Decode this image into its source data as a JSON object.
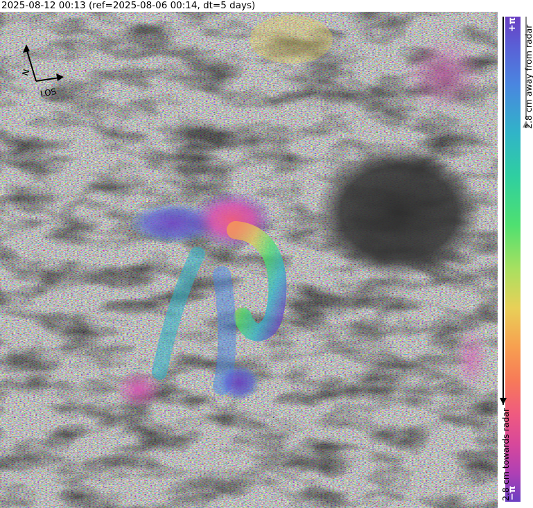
{
  "header": {
    "title": "2025-08-12 00:13 (ref=2025-08-06 00:14, dt=5 days)"
  },
  "compass": {
    "north_label": "N",
    "los_label": "LOS"
  },
  "colorbar": {
    "top_label": "+π",
    "bottom_label": "−π",
    "away_label": "2.8 cm away from radar",
    "towards_label": "2.8 cm towards radar"
  },
  "colors": {
    "magenta": "#d64fb0",
    "purple": "#6a3fc2",
    "blue": "#4a86e0",
    "cyan": "#30c0c0",
    "green": "#4fe070",
    "yellow": "#e8d058",
    "orange": "#f79050",
    "pink": "#ef5a80",
    "dark": "#2b2b2b"
  }
}
